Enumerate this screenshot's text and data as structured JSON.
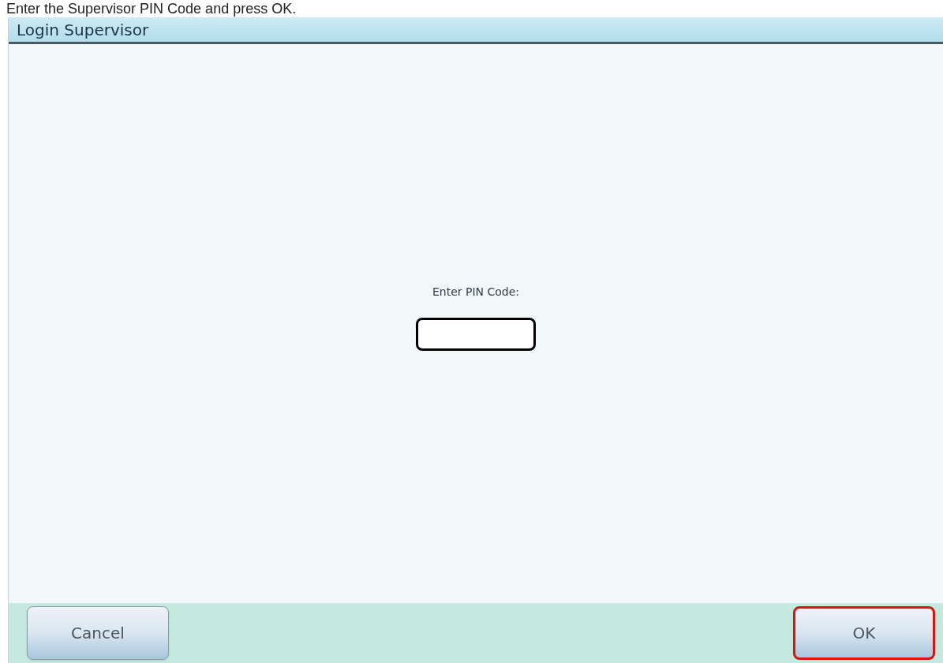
{
  "instruction": "Enter the Supervisor PIN Code and press OK.",
  "dialog": {
    "title": "Login Supervisor",
    "pin_label": "Enter PIN Code:",
    "buttons": [
      {
        "label": "Cancel",
        "highlighted": false
      },
      {
        "label": "OK",
        "highlighted": true
      }
    ]
  }
}
